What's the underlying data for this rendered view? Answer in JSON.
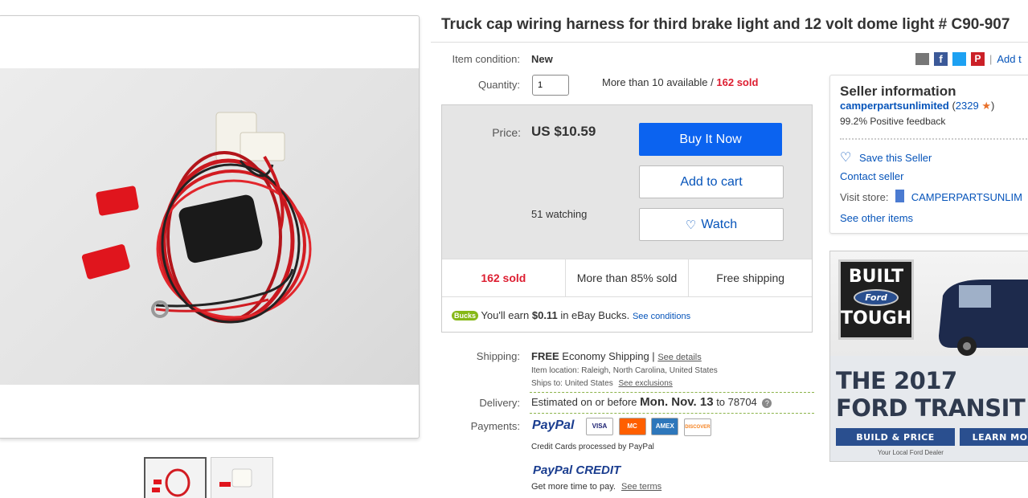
{
  "title": "Truck cap wiring harness for third brake light and 12 volt dome light # C90-907",
  "share": {
    "add_to_label": "Add t"
  },
  "condition": {
    "label": "Item condition:",
    "value": "New"
  },
  "quantity": {
    "label": "Quantity:",
    "value": "1",
    "available": "More than 10 available /",
    "sold": "162 sold"
  },
  "price": {
    "label": "Price:",
    "value": "US $10.59",
    "watching": "51 watching"
  },
  "buttons": {
    "buy_now": "Buy It Now",
    "add_to_cart": "Add to cart",
    "watch": "Watch"
  },
  "stats": {
    "sold": "162 sold",
    "percent_sold": "More than 85% sold",
    "shipping": "Free shipping"
  },
  "bucks": {
    "badge": "Bucks",
    "text_prefix": "You'll earn",
    "amount": "$0.11",
    "text_suffix": "in eBay Bucks.",
    "conditions_link": "See conditions"
  },
  "shipping": {
    "label": "Shipping:",
    "free": "FREE",
    "method": "Economy Shipping |",
    "details_link": "See details",
    "location": "Item location:  Raleigh, North Carolina, United States",
    "ships_to": "Ships to:  United States",
    "exclusions_link": "See exclusions"
  },
  "delivery": {
    "label": "Delivery:",
    "prefix": "Estimated on or before",
    "date": "Mon. Nov. 13",
    "suffix": "to 78704"
  },
  "payments": {
    "label": "Payments:",
    "paypal": "PayPal",
    "cards": [
      "VISA",
      "MC",
      "AMEX",
      "DISCOVER"
    ],
    "credit_note": "Credit Cards processed by PayPal",
    "paypal_credit": "PayPal CREDIT",
    "credit_tagline": "Get more time to pay.",
    "terms_link": "See terms"
  },
  "seller": {
    "heading": "Seller information",
    "name": "camperpartsunlimited",
    "score": "2329",
    "feedback": "99.2% Positive feedback",
    "save_seller": "Save this Seller",
    "contact": "Contact seller",
    "visit_store_label": "Visit store:",
    "store_name": "CAMPERPARTSUNLIM",
    "other_items": "See other items"
  },
  "ad": {
    "badge_line1": "BUILT",
    "badge_ford": "Ford",
    "badge_line2": "TOUGH",
    "headline1": "THE 2017",
    "headline2": "FORD TRANSIT",
    "btn1": "BUILD & PRICE",
    "btn2": "LEARN MO",
    "dealer": "Your Local Ford Dealer"
  },
  "colors": {
    "ebay_blue": "#0654ba",
    "buy_blue": "#0b63f0",
    "sold_red": "#dd1e31",
    "ford_blue": "#2a4f8f",
    "bucks_green": "#86b817"
  }
}
